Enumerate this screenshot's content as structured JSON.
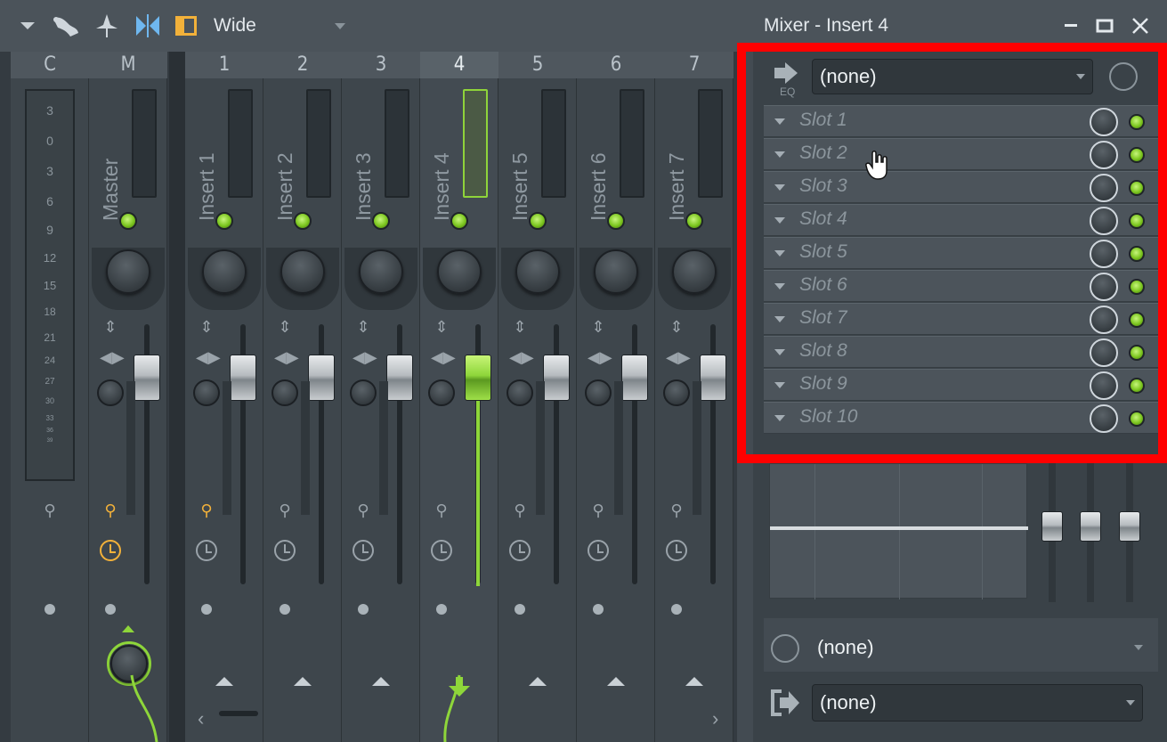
{
  "toolbar": {
    "menu_icon": "dropdown-arrow-icon",
    "layout_label": "Wide",
    "layout_caret": "▾"
  },
  "window": {
    "title": "Mixer - Insert 4",
    "minimize": "—",
    "maximize": "☐",
    "close": "✕"
  },
  "mixer": {
    "headers": [
      "C",
      "M",
      "1",
      "2",
      "3",
      "4",
      "5",
      "6",
      "7"
    ],
    "master_name": "Master",
    "inserts": [
      "Insert 1",
      "Insert 2",
      "Insert 3",
      "Insert 4",
      "Insert 5",
      "Insert 6",
      "Insert 7"
    ],
    "selected_insert": "4",
    "scale": [
      "3",
      "0",
      "3",
      "6",
      "9",
      "12",
      "15",
      "18",
      "21",
      "24",
      "27",
      "30",
      "33",
      "36",
      "39"
    ]
  },
  "fx": {
    "eq_label": "EQ",
    "preset": "(none)",
    "slots": [
      "Slot 1",
      "Slot 2",
      "Slot 3",
      "Slot 4",
      "Slot 5",
      "Slot 6",
      "Slot 7",
      "Slot 8",
      "Slot 9",
      "Slot 10"
    ]
  },
  "routing": {
    "input": "(none)",
    "output": "(none)"
  },
  "colors": {
    "accent_green": "#8ed63a",
    "highlight_red": "#ff0000",
    "orange": "#f2b13a"
  }
}
